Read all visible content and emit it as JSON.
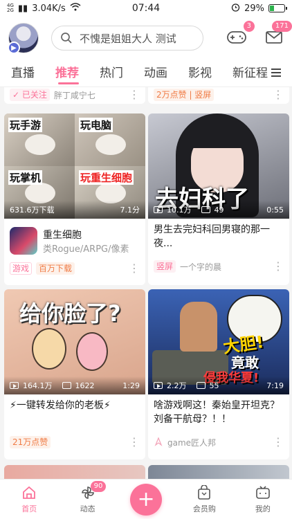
{
  "status_bar": {
    "carrier_top": "4G",
    "carrier_bottom": "2G",
    "speed": "3.04K/s",
    "time": "07:44",
    "battery": "29%",
    "battery_level": 0.29
  },
  "header": {
    "search_placeholder": "不愧是姐姐大人 测试",
    "game_badge": "3",
    "message_badge": "171"
  },
  "tabs": [
    {
      "label": "直播"
    },
    {
      "label": "推荐"
    },
    {
      "label": "热门"
    },
    {
      "label": "动画"
    },
    {
      "label": "影视"
    },
    {
      "label": "新征程"
    }
  ],
  "partial_cards": {
    "left": {
      "tag": "已关注",
      "author": "胖丁咸宁七"
    },
    "right": {
      "tag": "2万点赞 | 竖屏"
    }
  },
  "cards": [
    {
      "thumb_labels": [
        "玩手游",
        "玩电脑",
        "玩掌机",
        "玩重生细胞"
      ],
      "stat1": "631.6万下载",
      "stat2": "7.1分",
      "game_title": "重生细胞",
      "game_genre": "类Rogue/ARPG/像素",
      "tag1": "游戏",
      "tag2": "百万下载"
    },
    {
      "thumb_text": "去妇科了",
      "views": "10.1万",
      "danmaku": "49",
      "duration": "0:55",
      "title": "男生去完妇科回男寝的那一夜...",
      "tag": "竖屏",
      "author": "一个字的晨"
    },
    {
      "thumb_text": "给你脸了?",
      "views": "164.1万",
      "danmaku": "1622",
      "duration": "1:29",
      "title": "⚡一键转发给你的老板⚡",
      "tag": "21万点赞"
    },
    {
      "thumb_text1": "大胆!",
      "thumb_text2": "竟敢",
      "thumb_text3": "侵我华夏!",
      "views": "2.2万",
      "danmaku": "55",
      "duration": "7:19",
      "title": "啥游戏啊这！秦始皇开坦克？刘备干航母？！！",
      "author": "game匠人邦"
    }
  ],
  "bottom_nav": [
    {
      "label": "首页"
    },
    {
      "label": "动态",
      "badge": "90"
    },
    {
      "label": ""
    },
    {
      "label": "会员购"
    },
    {
      "label": "我的"
    }
  ],
  "colors": {
    "accent": "#fb7299",
    "orange": "#f07c46"
  }
}
